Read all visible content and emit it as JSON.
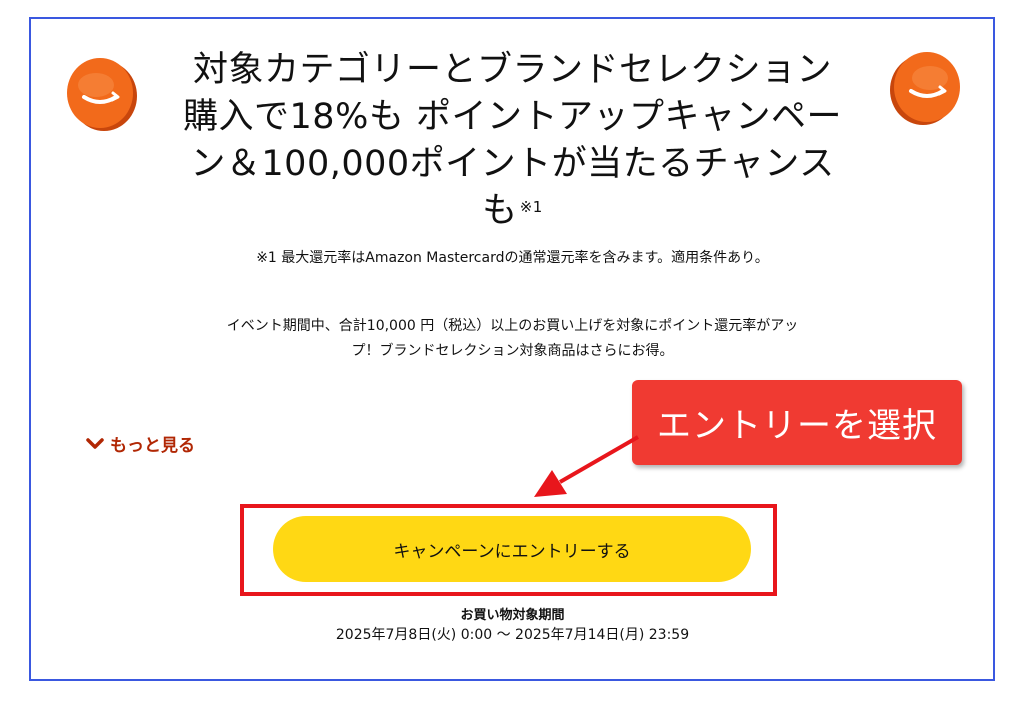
{
  "headline": {
    "lines": [
      "対象カテゴリーとブランドセレクション",
      "購入で18%も ポイントアップキャンペー",
      "ン＆100,000ポイントが当たるチャンス",
      "も"
    ],
    "footnote_mark": "※1"
  },
  "footnote": "※1 最大還元率はAmazon Mastercardの通常還元率を含みます。適用条件あり。",
  "description": {
    "lines": [
      "イベント期間中、合計10,000 円（税込）以上のお買い上げを対象にポイント還元率がアッ",
      "プ！ブランドセレクション対象商品はさらにお得。"
    ]
  },
  "more_link": {
    "label": "もっと見る",
    "icon": "chevron-down-icon"
  },
  "callout": {
    "label": "エントリーを選択",
    "color": "#f03a32"
  },
  "entry_button": {
    "label": "キャンペーンにエントリーする",
    "color": "#ffd814"
  },
  "period": {
    "title": "お買い物対象期間",
    "range": "2025年7月8日(火) 0:00 〜 2025年7月14日(月) 23:59"
  },
  "icons": {
    "left_coin": "amazon-coin-icon",
    "right_coin": "amazon-coin-icon"
  },
  "colors": {
    "frame_border": "#3a58e0",
    "coin": "#f26a1b",
    "link": "#b12704",
    "highlight_border": "#e8161c"
  }
}
